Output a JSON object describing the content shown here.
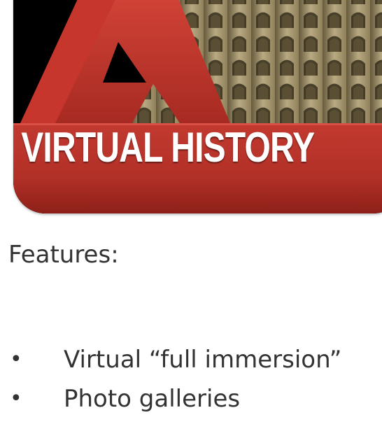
{
  "app_icon": {
    "title": "VIRTUAL HISTORY",
    "icon_name": "colosseum-app-icon",
    "colors": {
      "background": "#000000",
      "accent_red": "#c0362c",
      "stone": "#b9a77c",
      "title_text": "#ffffff"
    }
  },
  "content": {
    "heading": "Features:",
    "features": [
      {
        "bullet": "•",
        "text": "Virtual “full immersion”"
      },
      {
        "bullet": "•",
        "text": "Photo galleries"
      }
    ]
  }
}
